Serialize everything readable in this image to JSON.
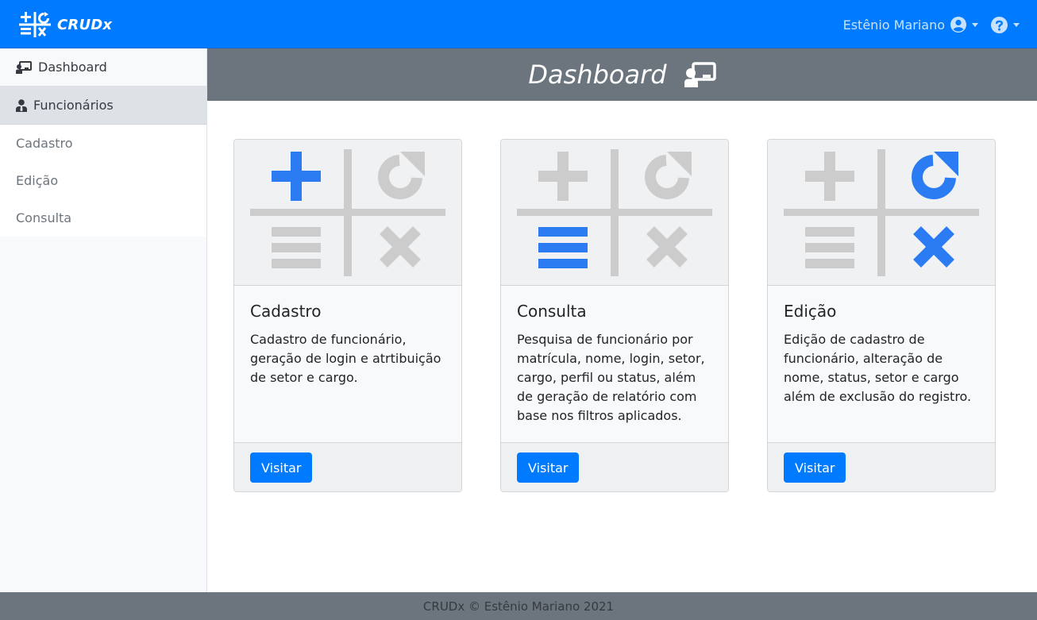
{
  "navbar": {
    "brand": "CRUDx",
    "user_name": "Estênio Mariano",
    "accent_color": "#007bff"
  },
  "sidebar": {
    "items": [
      {
        "label": "Dashboard",
        "icon": "presentation-user-icon"
      },
      {
        "label": "Funcionários",
        "icon": "user-tie-icon"
      }
    ],
    "links": [
      {
        "label": "Cadastro"
      },
      {
        "label": "Edição"
      },
      {
        "label": "Consulta"
      }
    ]
  },
  "header": {
    "title": "Dashboard",
    "icon": "presentation-user-icon",
    "background": "#6c757d"
  },
  "cards": [
    {
      "title": "Cadastro",
      "text": "Cadastro de funcionário, geração de login e atrtibuição de setor e cargo.",
      "button": "Visitar",
      "highlight": "plus"
    },
    {
      "title": "Consulta",
      "text": "Pesquisa de funcionário por matrícula, nome, login, setor, cargo, perfil ou status, além de geração de relatório com base nos filtros aplicados.",
      "button": "Visitar",
      "highlight": "equals"
    },
    {
      "title": "Edição",
      "text": "Edição de cadastro de funcionário, alteração de nome, status, setor e cargo além de exclusão do registro.",
      "button": "Visitar",
      "highlight": "refresh-and-x"
    }
  ],
  "footer": {
    "text": "CRUDx © Estênio Mariano 2021"
  },
  "colors": {
    "highlight_blue": "#2b7bf3",
    "muted_gray": "#cccccc"
  }
}
